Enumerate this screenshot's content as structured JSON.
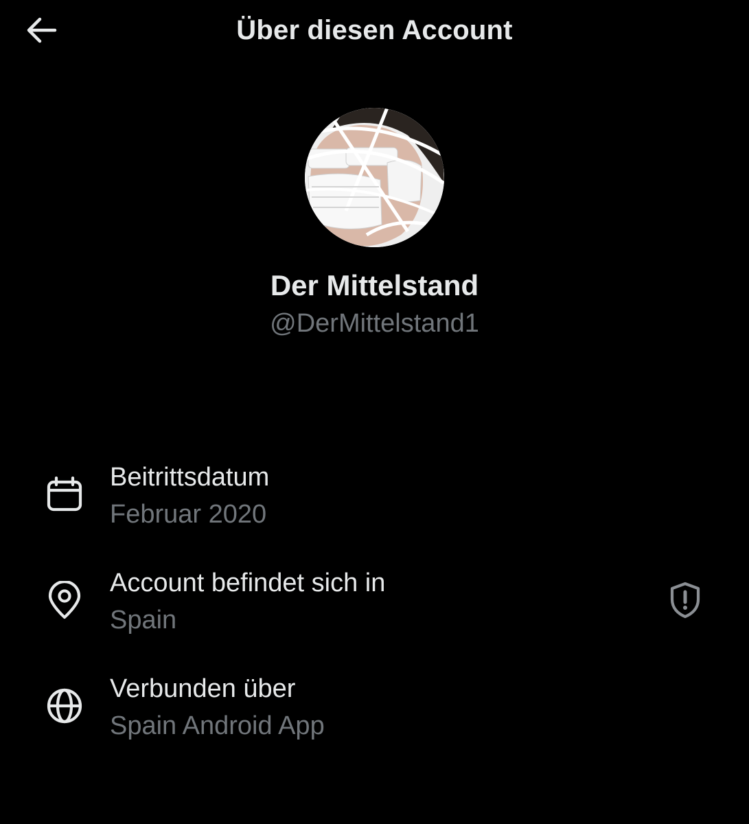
{
  "header": {
    "title": "Über diesen Account",
    "back_icon": "arrow-left-icon"
  },
  "profile": {
    "display_name": "Der Mittelstand",
    "handle": "@DerMittelstand1",
    "avatar_description": "profile-photo"
  },
  "info": {
    "joined": {
      "label": "Beitrittsdatum",
      "value": "Februar 2020",
      "icon": "calendar-icon"
    },
    "location": {
      "label": "Account befindet sich in",
      "value": "Spain",
      "icon": "location-pin-icon",
      "trailing_icon": "shield-alert-icon"
    },
    "connected": {
      "label": "Verbunden über",
      "value": "Spain Android App",
      "icon": "globe-icon"
    }
  },
  "colors": {
    "background": "#000000",
    "primary_text": "#e7e9ea",
    "secondary_text": "#71767b",
    "shield_icon": "#8b8f94"
  }
}
